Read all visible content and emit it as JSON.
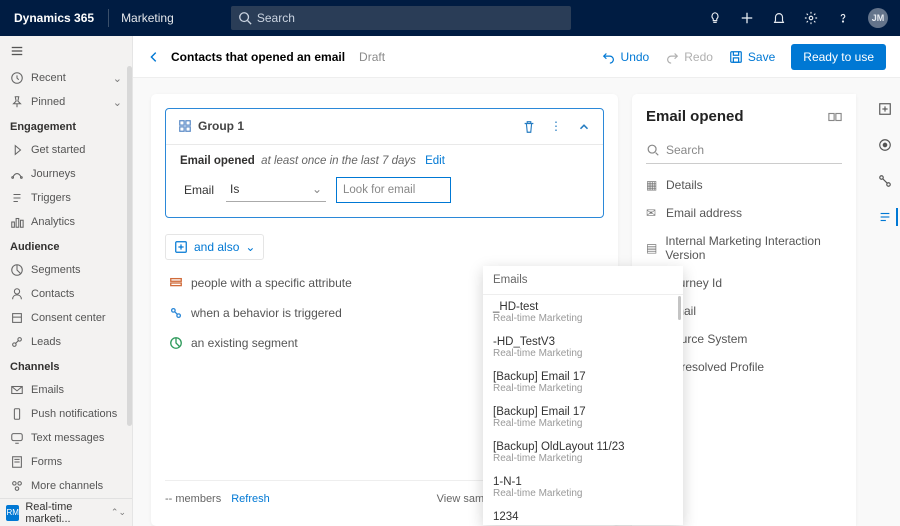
{
  "topbar": {
    "brand": "Dynamics 365",
    "module": "Marketing",
    "search_placeholder": "Search",
    "avatar_initials": "JM"
  },
  "sidebar": {
    "recent": "Recent",
    "pinned": "Pinned",
    "sections": [
      {
        "title": "Engagement",
        "items": [
          "Get started",
          "Journeys",
          "Triggers",
          "Analytics"
        ]
      },
      {
        "title": "Audience",
        "items": [
          "Segments",
          "Contacts",
          "Consent center",
          "Leads"
        ]
      },
      {
        "title": "Channels",
        "items": [
          "Emails",
          "Push notifications",
          "Text messages",
          "Forms",
          "More channels"
        ]
      }
    ],
    "footer": {
      "badge": "RM",
      "label": "Real-time marketi..."
    }
  },
  "cmdbar": {
    "title": "Contacts that opened an email",
    "status": "Draft",
    "undo": "Undo",
    "redo": "Redo",
    "save": "Save",
    "ready": "Ready to use"
  },
  "group": {
    "name": "Group 1",
    "cond_name": "Email opened",
    "cond_qual": "at least once in the last 7 days",
    "cond_edit": "Edit",
    "field_label": "Email",
    "op_value": "Is",
    "lookup_placeholder": "Look for email"
  },
  "andalso": "and also",
  "blocks": {
    "attr": "people with a specific attribute",
    "beh": "when a behavior is triggered",
    "seg": "an existing segment"
  },
  "dropdown": {
    "heading": "Emails",
    "items": [
      {
        "t1": "_HD-test",
        "t2": "Real-time Marketing"
      },
      {
        "t1": "-HD_TestV3",
        "t2": "Real-time Marketing"
      },
      {
        "t1": "[Backup] Email 17",
        "t2": "Real-time Marketing"
      },
      {
        "t1": "[Backup] Email 17",
        "t2": "Real-time Marketing"
      },
      {
        "t1": "[Backup] OldLayout 11/23",
        "t2": "Real-time Marketing"
      },
      {
        "t1": "1-N-1",
        "t2": "Real-time Marketing"
      },
      {
        "t1": "1234",
        "t2": ""
      }
    ]
  },
  "footer": {
    "members": "-- members",
    "refresh": "Refresh",
    "sample": "View sample of included members"
  },
  "rpanel": {
    "title": "Email opened",
    "search_placeholder": "Search",
    "attrs": [
      "Details",
      "Email address",
      "Internal Marketing Interaction Version",
      "Journey Id",
      "Email",
      "Source System",
      "Unresolved Profile"
    ]
  }
}
